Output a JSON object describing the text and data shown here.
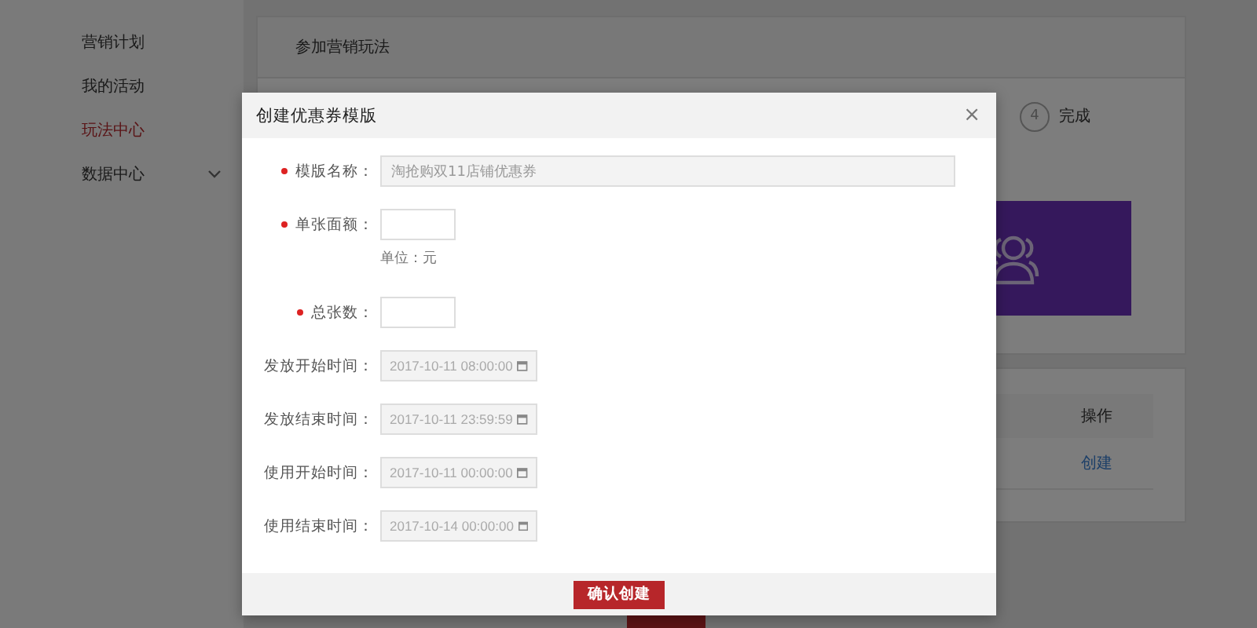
{
  "sidebar": {
    "items": [
      {
        "label": "营销计划",
        "selected": false,
        "expandable": false
      },
      {
        "label": "我的活动",
        "selected": false,
        "expandable": false
      },
      {
        "label": "玩法中心",
        "selected": true,
        "expandable": false
      },
      {
        "label": "数据中心",
        "selected": false,
        "expandable": true
      }
    ]
  },
  "page": {
    "card_title": "参加营销玩法",
    "steps": [
      {
        "number": "4",
        "label": "完成"
      }
    ],
    "table": {
      "columns": [
        "操作"
      ],
      "rows": [
        [
          "创建"
        ]
      ]
    }
  },
  "dialog": {
    "title": "创建优惠券模版",
    "close": "×",
    "fields": [
      {
        "kind": "text",
        "label": "模版名称：",
        "required": true,
        "disabled": true,
        "value": "淘抢购双11店铺优惠券"
      },
      {
        "kind": "number",
        "label": "单张面额：",
        "required": true,
        "disabled": false,
        "hint": "单位：元"
      },
      {
        "kind": "number",
        "label": "总张数：",
        "required": true,
        "disabled": false
      },
      {
        "kind": "date",
        "label": "发放开始时间：",
        "required": false,
        "disabled": true,
        "value": "2017-10-11 08:00:00"
      },
      {
        "kind": "date",
        "label": "发放结束时间：",
        "required": false,
        "disabled": true,
        "value": "2017-10-11 23:59:59"
      },
      {
        "kind": "date",
        "label": "使用开始时间：",
        "required": false,
        "disabled": true,
        "value": "2017-10-11 00:00:00"
      },
      {
        "kind": "date",
        "label": "使用结束时间：",
        "required": false,
        "disabled": true,
        "value": "2017-10-14 00:00:00"
      }
    ],
    "confirm_button": "确认创建"
  }
}
